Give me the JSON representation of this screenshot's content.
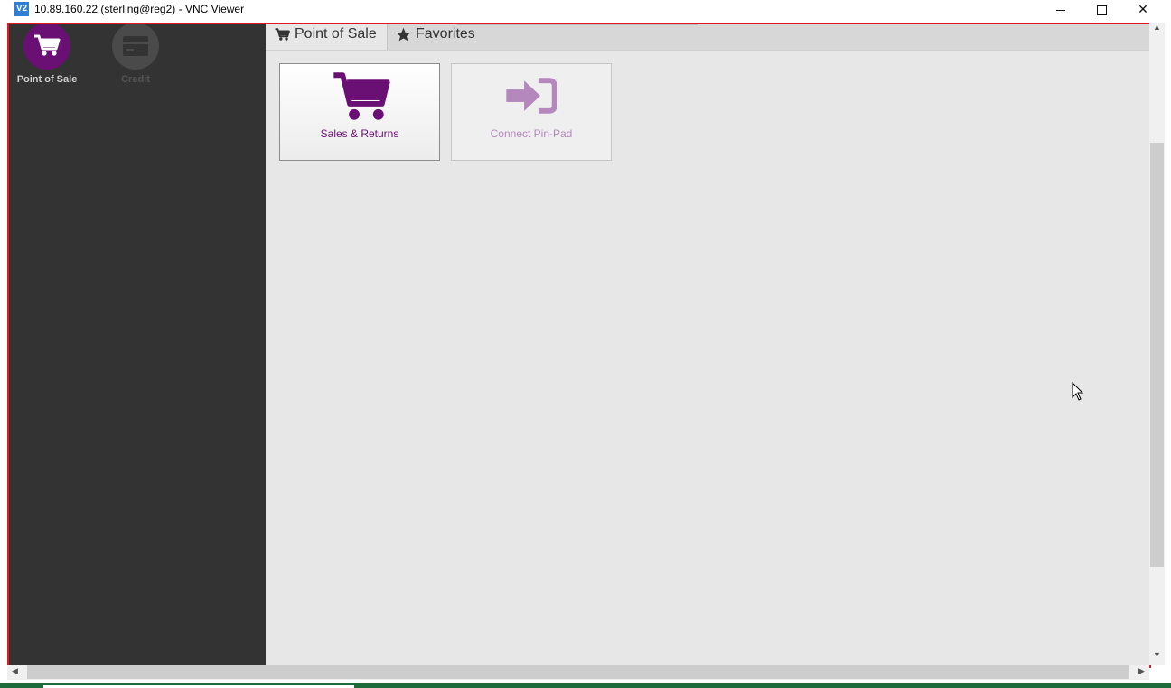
{
  "window": {
    "icon_text": "V2",
    "title": "10.89.160.22 (sterling@reg2) - VNC Viewer",
    "close_glyph": "✕"
  },
  "sidebar": {
    "items": [
      {
        "label": "Point of Sale",
        "icon": "shopping-cart-icon",
        "active": true
      },
      {
        "label": "Credit",
        "icon": "credit-card-icon",
        "active": false
      }
    ]
  },
  "tabs": [
    {
      "label": "Point of Sale",
      "icon": "shopping-cart-icon",
      "active": true
    },
    {
      "label": "Favorites",
      "icon": "star-icon",
      "active": false
    }
  ],
  "tiles": [
    {
      "label": "Sales & Returns",
      "icon": "shopping-cart-icon",
      "enabled": true
    },
    {
      "label": "Connect Pin-Pad",
      "icon": "sign-in-icon",
      "enabled": false
    }
  ],
  "colors": {
    "accent": "#6a0f73",
    "accent_disabled": "#b488bd",
    "sidebar_bg": "#333333",
    "content_bg": "#e7e7e7",
    "frame_border": "#e0191e"
  }
}
